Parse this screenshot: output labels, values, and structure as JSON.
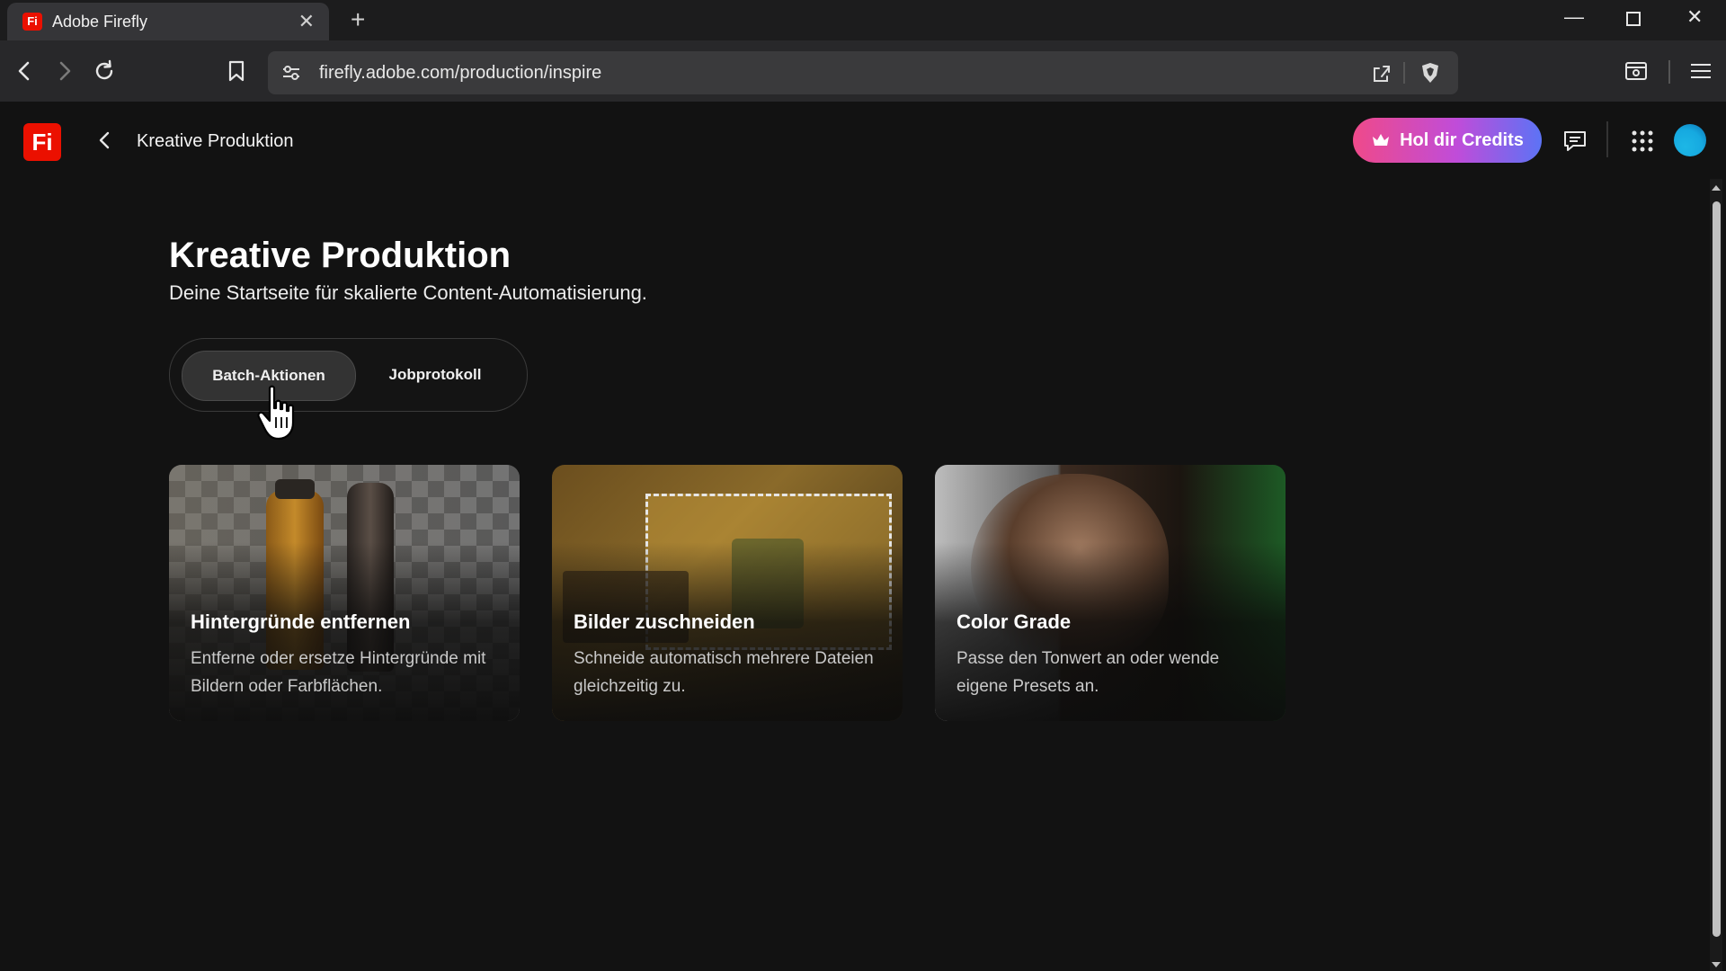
{
  "browser": {
    "tab_title": "Adobe Firefly",
    "tab_favicon": "Fi",
    "url": "firefly.adobe.com/production/inspire",
    "icons": [
      "back-icon",
      "forward-icon",
      "reload-icon",
      "bookmark-icon",
      "site-settings-icon",
      "share-icon",
      "brave-shield-icon",
      "sidebar-icon",
      "menu-icon",
      "new-tab-icon",
      "minimize-icon",
      "maximize-icon",
      "close-icon"
    ]
  },
  "header": {
    "logo": "Fi",
    "title": "Kreative Produktion",
    "credits_label": "Hol dir Credits"
  },
  "main": {
    "title": "Kreative Produktion",
    "subtitle": "Deine Startseite für skalierte Content-Automatisierung.",
    "tabs": [
      {
        "label": "Batch-Aktionen",
        "active": true
      },
      {
        "label": "Jobprotokoll",
        "active": false
      }
    ],
    "cards": [
      {
        "title": "Hintergründe entfernen",
        "description": "Entferne oder ersetze Hintergründe mit Bildern oder Farbflächen."
      },
      {
        "title": "Bilder zuschneiden",
        "description": "Schneide automatisch mehrere Dateien gleichzeitig zu."
      },
      {
        "title": "Color Grade",
        "description": "Passe den Tonwert an oder wende eigene Presets an."
      }
    ]
  },
  "colors": {
    "background": "#121212",
    "brand_red": "#eb1000",
    "credits_gradient": [
      "#ef4a8a",
      "#c04cd9",
      "#5c73f5"
    ]
  }
}
